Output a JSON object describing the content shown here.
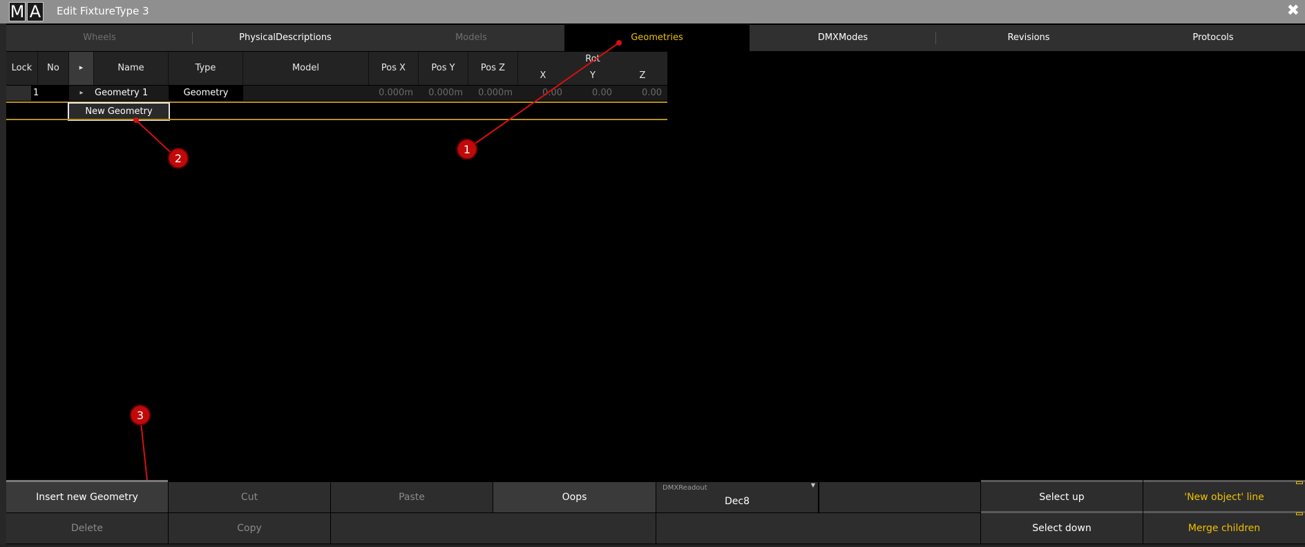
{
  "window": {
    "logo_m": "M",
    "logo_a": "A",
    "title": "Edit FixtureType 3",
    "close_icon": "✖"
  },
  "tabs": [
    {
      "label": "Wheels",
      "state": "disabled"
    },
    {
      "label": "PhysicalDescriptions",
      "state": "normal"
    },
    {
      "label": "Models",
      "state": "disabled"
    },
    {
      "label": "Geometries",
      "state": "active"
    },
    {
      "label": "DMXModes",
      "state": "normal"
    },
    {
      "label": "Revisions",
      "state": "normal"
    },
    {
      "label": "Protocols",
      "state": "normal"
    }
  ],
  "table": {
    "headers": {
      "lock": "Lock",
      "no": "No",
      "expand": "▸",
      "name": "Name",
      "type": "Type",
      "model": "Model",
      "pos_x": "Pos X",
      "pos_y": "Pos Y",
      "pos_z": "Pos Z",
      "rot": "Rot",
      "rot_x": "X",
      "rot_y": "Y",
      "rot_z": "Z"
    },
    "rows": [
      {
        "no": "1",
        "expand": "▸",
        "name": "Geometry 1",
        "type": "Geometry",
        "model": "",
        "pos_x": "0.000m",
        "pos_y": "0.000m",
        "pos_z": "0.000m",
        "rot_x": "0.00",
        "rot_y": "0.00",
        "rot_z": "0.00"
      }
    ],
    "new_row_label": "New Geometry"
  },
  "callouts": [
    "1",
    "2",
    "3"
  ],
  "bottom_bar": {
    "insert": "Insert new Geometry",
    "cut": "Cut",
    "paste": "Paste",
    "oops": "Oops",
    "dmx_readout_label": "DMXReadout",
    "dmx_readout_value": "Dec8",
    "select_up": "Select up",
    "new_object_line": "'New object' line",
    "delete": "Delete",
    "copy": "Copy",
    "select_down": "Select down",
    "merge_children": "Merge children"
  },
  "colors": {
    "accent": "#f0c000",
    "callout": "#c00a0a",
    "row_border": "#b89020"
  }
}
